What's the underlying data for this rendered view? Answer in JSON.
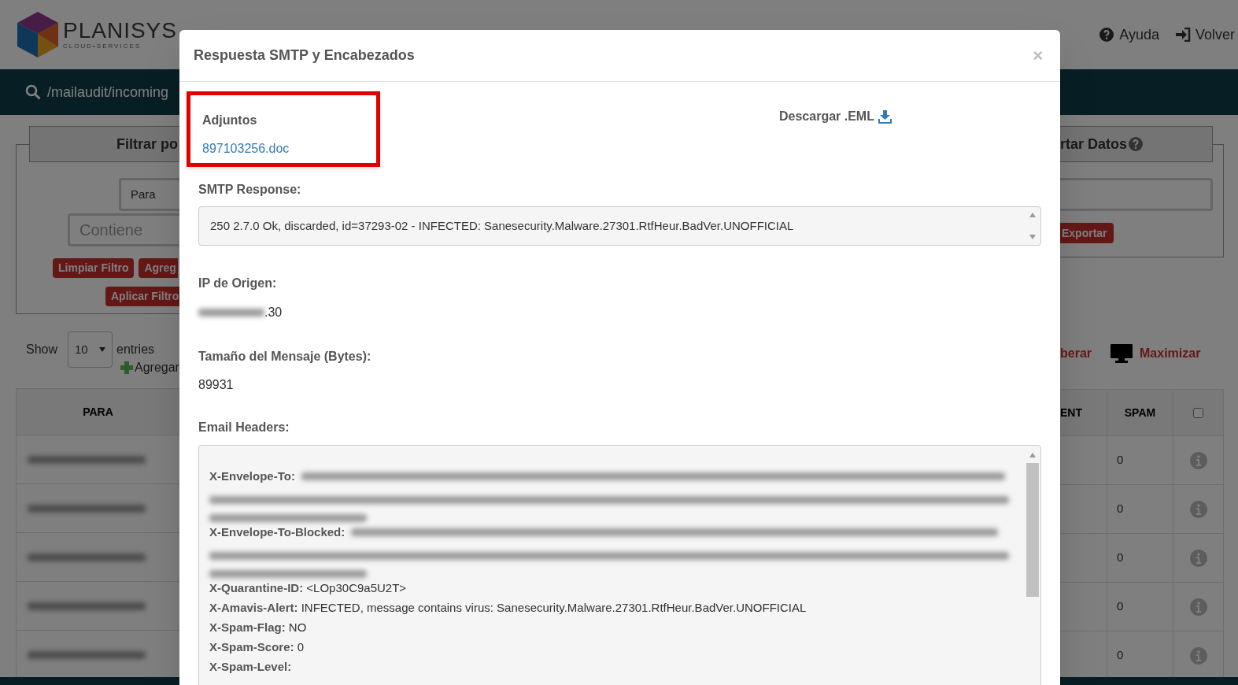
{
  "nav": {
    "logo": {
      "name": "PLANISYS",
      "tagline": "CLOUD•SERVICES"
    },
    "items": [
      {
        "label": "Ayuda"
      },
      {
        "label": "Volver"
      }
    ]
  },
  "path_bar": {
    "path": "/mailaudit/incoming"
  },
  "filter_panel": {
    "title": "Filtrar po",
    "field_select": "Para",
    "operator_placeholder": "Contiene",
    "buttons": [
      "Limpiar Filtro",
      "Agreg"
    ],
    "apply_button": "Aplicar Filtro"
  },
  "export_panel": {
    "title": "rtar Datos",
    "button": "Exportar"
  },
  "table_controls": {
    "show_label": "Show",
    "page_size": "10",
    "entries_label": "entries",
    "add_label": "Agregar",
    "release_label": "berar",
    "maximize_label": "Maximizar"
  },
  "table": {
    "columns": [
      "PARA",
      "ENT",
      "SPAM"
    ],
    "select_all": {
      "checked": false
    },
    "rows": [
      {
        "spam": "0"
      },
      {
        "spam": "0"
      },
      {
        "spam": "0"
      },
      {
        "spam": "0"
      },
      {
        "spam": "0"
      }
    ]
  },
  "modal": {
    "title": "Respuesta SMTP y Encabezados",
    "close": "×",
    "attachments": {
      "label": "Adjuntos",
      "files": [
        "897103256.doc"
      ],
      "highlighted": true
    },
    "download": "Descargar .EML",
    "smtp_response": {
      "label": "SMTP Response:",
      "value": "250 2.7.0 Ok, discarded, id=37293-02 - INFECTED: Sanesecurity.Malware.27301.RtfHeur.BadVer.UNOFFICIAL"
    },
    "origin_ip": {
      "label": "IP de Origen:",
      "value": ".30"
    },
    "size": {
      "label": "Tamaño del Mensaje (Bytes):",
      "value": "89931"
    },
    "headers": {
      "label": "Email Headers:",
      "lines": [
        {
          "name": "X-Envelope-To:",
          "kind": "blurred"
        },
        {
          "name": "X-Envelope-To-Blocked:",
          "kind": "blurred"
        },
        {
          "name": "X-Quarantine-ID:",
          "kind": "text",
          "value": "<LOp30C9a5U2T>"
        },
        {
          "name": "X-Amavis-Alert:",
          "kind": "text",
          "value": "INFECTED, message contains virus: Sanesecurity.Malware.27301.RtfHeur.BadVer.UNOFFICIAL"
        },
        {
          "name": "X-Spam-Flag:",
          "kind": "text",
          "value": "NO"
        },
        {
          "name": "X-Spam-Score:",
          "kind": "text",
          "value": "0"
        },
        {
          "name": "X-Spam-Level:",
          "kind": "text"
        }
      ]
    }
  }
}
